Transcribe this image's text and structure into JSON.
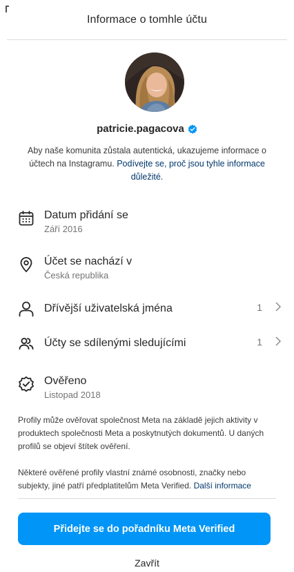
{
  "header": {
    "title": "Informace o tomhle účtu"
  },
  "profile": {
    "username": "patricie.pagacova",
    "verified": true,
    "badge_color": "#0095f6"
  },
  "intro": {
    "text": "Aby naše komunita zůstala autentická, ukazujeme informace o účtech na Instagramu. ",
    "link": "Podívejte se, proč jsou tyhle informace důležité."
  },
  "rows": {
    "date_joined": {
      "icon": "calendar-icon",
      "title": "Datum přidání se",
      "value": "Září 2016"
    },
    "location": {
      "icon": "location-pin-icon",
      "title": "Účet se nachází v",
      "value": "Česká republika"
    },
    "former_usernames": {
      "icon": "user-outline-icon",
      "title": "Dřívější uživatelská jména",
      "count": "1"
    },
    "shared_followers": {
      "icon": "users-icon",
      "title": "Účty se sdílenými sledujícími",
      "count": "1"
    },
    "verified": {
      "icon": "verified-badge-icon",
      "title": "Ověřeno",
      "value": "Listopad 2018"
    }
  },
  "notes": {
    "verification": "Profily může ověřovat společnost Meta na základě jejich aktivity v produktech společnosti Meta a poskytnutých dokumentů. U daných profilů se objeví štítek ověření.",
    "meta_verified": "Některé ověřené profily vlastní známé osobnosti, značky nebo subjekty, jiné patří předplatitelům Meta Verified. ",
    "more_link": "Další informace"
  },
  "actions": {
    "cta_label": "Přidejte se do pořadníku Meta Verified",
    "close_label": "Zavřít"
  },
  "colors": {
    "accent": "#0095f6",
    "link": "#00376b",
    "secondary_text": "#737373"
  }
}
